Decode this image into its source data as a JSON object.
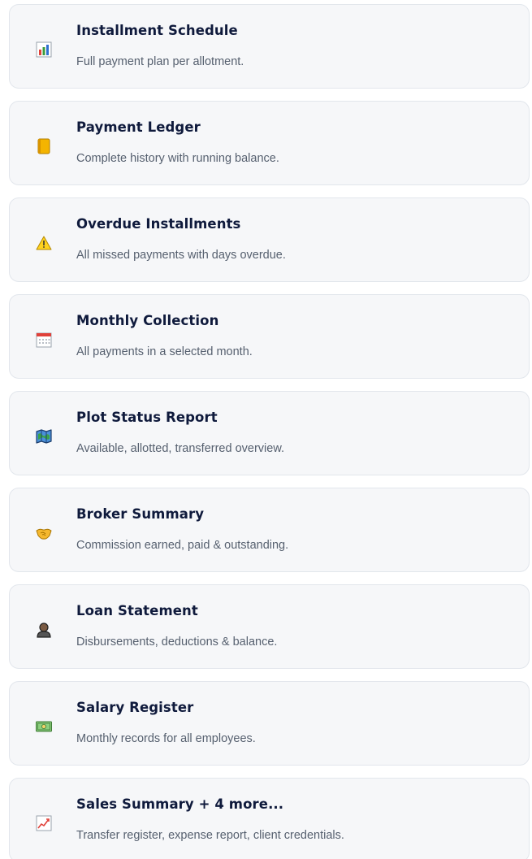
{
  "reports": [
    {
      "title": "Installment Schedule",
      "description": "Full payment plan per allotment.",
      "icon": "bar-chart-icon"
    },
    {
      "title": "Payment Ledger",
      "description": "Complete history with running balance.",
      "icon": "ledger-book-icon"
    },
    {
      "title": "Overdue Installments",
      "description": "All missed payments with days overdue.",
      "icon": "warning-icon"
    },
    {
      "title": "Monthly Collection",
      "description": "All payments in a selected month.",
      "icon": "calendar-icon"
    },
    {
      "title": "Plot Status Report",
      "description": "Available, allotted, transferred overview.",
      "icon": "map-icon"
    },
    {
      "title": "Broker Summary",
      "description": "Commission earned, paid & outstanding.",
      "icon": "handshake-icon"
    },
    {
      "title": "Loan Statement",
      "description": "Disbursements, deductions & balance.",
      "icon": "person-icon"
    },
    {
      "title": "Salary Register",
      "description": "Monthly records for all employees.",
      "icon": "money-icon"
    },
    {
      "title": "Sales Summary + 4 more...",
      "description": "Transfer register, expense report, client credentials.",
      "icon": "trend-chart-icon"
    }
  ],
  "colors": {
    "card_background": "#f6f7f9",
    "card_border": "#e2e6ec",
    "title": "#0f1a3c",
    "description": "#56606f"
  }
}
